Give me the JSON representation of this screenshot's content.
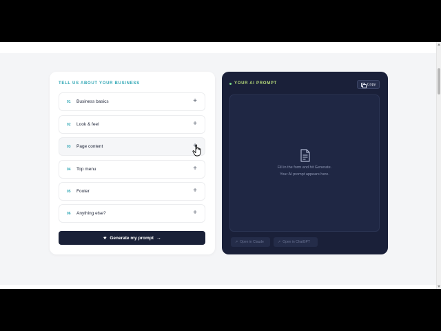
{
  "left_panel": {
    "heading": "TELL US ABOUT YOUR BUSINESS",
    "sections": [
      {
        "num": "01",
        "label": "Business basics"
      },
      {
        "num": "02",
        "label": "Look & feel"
      },
      {
        "num": "03",
        "label": "Page content"
      },
      {
        "num": "04",
        "label": "Top menu"
      },
      {
        "num": "05",
        "label": "Footer"
      },
      {
        "num": "06",
        "label": "Anything else?"
      }
    ],
    "expand_symbol": "+",
    "generate_button": "Generate my prompt",
    "generate_icons": {
      "leading": "star-icon",
      "trailing": "arrow-right-icon"
    }
  },
  "right_panel": {
    "heading": "YOUR AI PROMPT",
    "copy_button": "Copy",
    "empty_state": {
      "line1": "Fill in the form and hit Generate.",
      "line2": "Your AI prompt appears here.",
      "icon": "document-icon"
    },
    "open_claude": "Open in Claude",
    "open_chatgpt": "Open in ChatGPT"
  },
  "colors": {
    "accent_teal": "#2fa6b4",
    "navy": "#1a2039",
    "green_accent": "#b8dc7a",
    "button_dark": "#1a2138"
  }
}
